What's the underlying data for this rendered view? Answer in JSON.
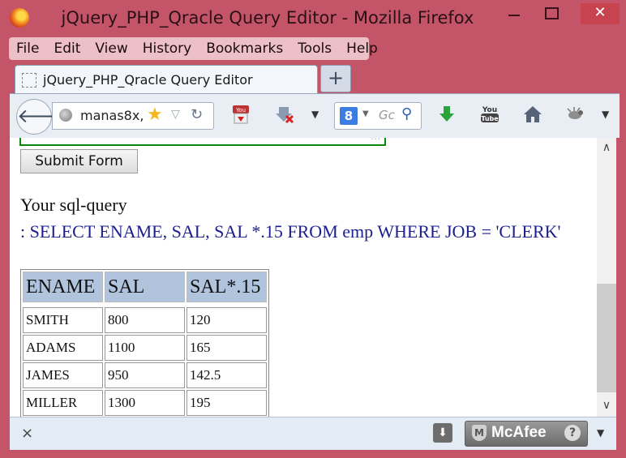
{
  "window": {
    "title": "jQuery_PHP_Qracle Query Editor - Mozilla Firefox",
    "minimize": "",
    "maximize": "",
    "close": "✕"
  },
  "menu": {
    "items": [
      "File",
      "Edit",
      "View",
      "History",
      "Bookmarks",
      "Tools",
      "Help"
    ]
  },
  "tabs": [
    {
      "label": "jQuery_PHP_Qracle Query Editor"
    }
  ],
  "newtab_label": "+",
  "nav": {
    "back": "🡐",
    "url": "manas8x,",
    "search_placeholder": "Gc",
    "search_engine": "8"
  },
  "icons": {
    "back": "arrow-left-icon",
    "site": "globe-icon",
    "bookmark": "star-icon",
    "reload": "reload-icon",
    "youtube_dl": "youtube-download-icon",
    "download_addon": "download-cancel-icon",
    "green_download": "download-arrow-icon",
    "youtube": "youtube-icon",
    "home": "home-icon",
    "addon_bug": "bug-icon"
  },
  "page": {
    "submit_label": "Submit Form",
    "sql_label": "Your sql-query",
    "sql_query": ": SELECT ENAME, SAL, SAL *.15 FROM emp WHERE JOB = 'CLERK'",
    "table": {
      "headers": [
        "ENAME",
        "SAL",
        "SAL*.15"
      ],
      "rows": [
        [
          "SMITH",
          "800",
          "120"
        ],
        [
          "ADAMS",
          "1100",
          "165"
        ],
        [
          "JAMES",
          "950",
          "142.5"
        ],
        [
          "MILLER",
          "1300",
          "195"
        ]
      ]
    }
  },
  "addonbar": {
    "close": "×",
    "download": "⬇",
    "mcafee_label": "McAfee",
    "mcafee_help": "?",
    "dropdown": "▼"
  },
  "colors": {
    "titlebar": "#c45569",
    "header_bg": "#b0c4de",
    "query_text": "#1d1f8c",
    "textarea_border": "#0a8a0a"
  }
}
